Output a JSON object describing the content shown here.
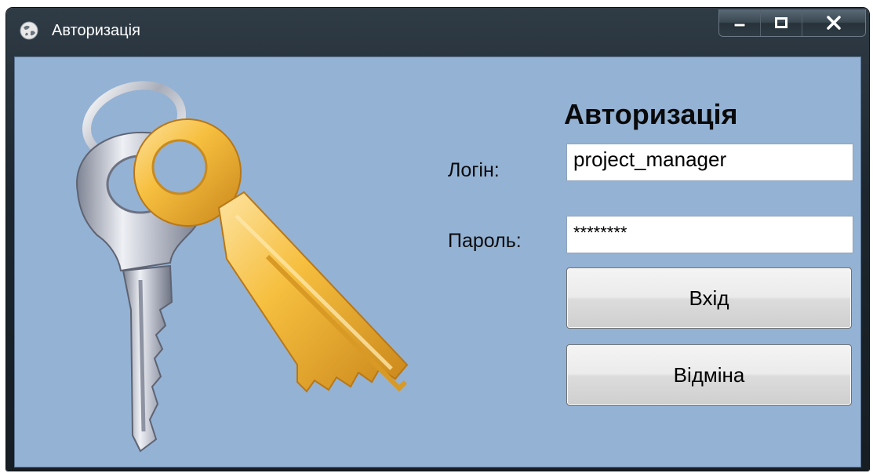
{
  "window": {
    "title": "Авторизація",
    "app_icon": "app-globe-icon",
    "controls": {
      "minimize": "minimize-icon",
      "maximize": "maximize-icon",
      "close": "close-icon"
    }
  },
  "form": {
    "heading": "Авторизація",
    "login_label": "Логін:",
    "login_value": "project_manager",
    "password_label": "Пароль:",
    "password_value": "********",
    "enter_button": "Вхід",
    "cancel_button": "Відміна"
  },
  "illustration": "keys-icon",
  "colors": {
    "client_background": "#94b2d4",
    "titlebar": "#1d262e",
    "key_gold": "#f2b43a",
    "key_silver": "#c9ccd6"
  }
}
